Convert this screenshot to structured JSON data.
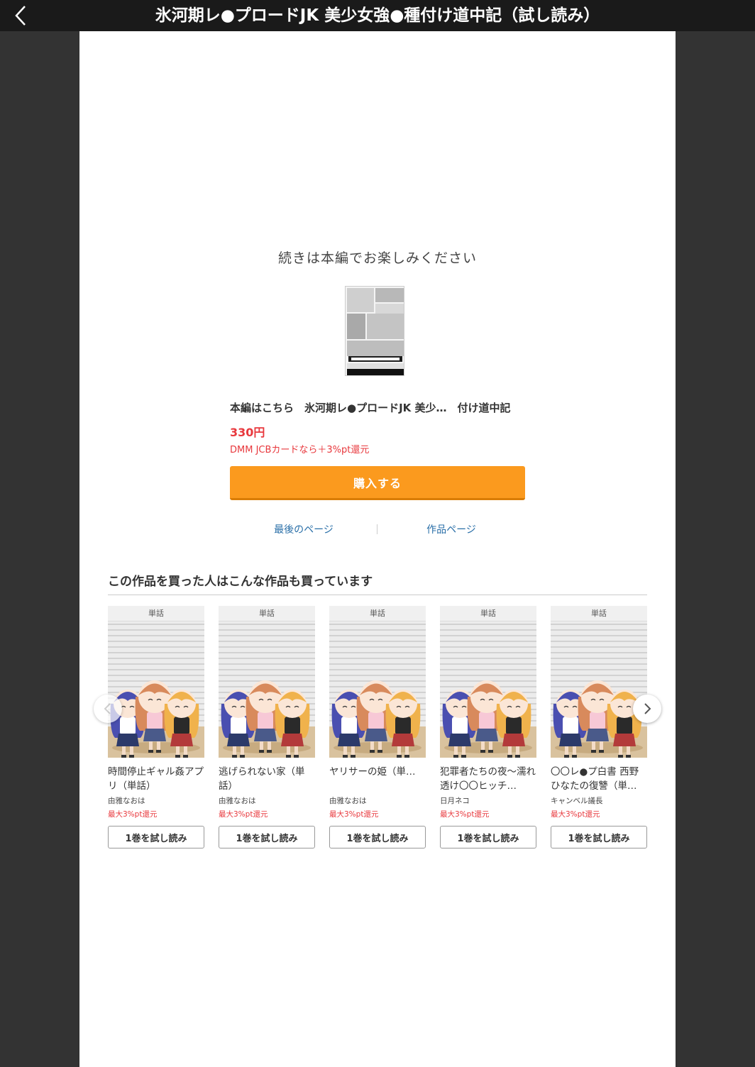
{
  "header": {
    "title": "氷河期レ●プロードJK 美少女強●種付け道中記（試し読み）",
    "back_icon": "chevron-left-icon"
  },
  "end_screen": {
    "message": "続きは本編でお楽しみください",
    "cover_alt": "氷河期レ●プロードJK 美少女強●種付け道中記 cover",
    "buy_title": "本編はこちら　氷河期レ●プロードJK 美少…　付け道中記",
    "price": "330円",
    "point_note": "DMM JCBカードなら＋3%pt還元",
    "buy_button": "購入する",
    "last_page_link": "最後のページ",
    "work_page_link": "作品ページ"
  },
  "recommendations": {
    "heading": "この作品を買った人はこんな作品も買っています",
    "items": [
      {
        "tag": "単話",
        "title": "時間停止ギャル姦アプリ（単話）",
        "author": "由雅なおは",
        "point": "最大3%pt還元",
        "button": "1巻を試し読み"
      },
      {
        "tag": "単話",
        "title": "逃げられない家（単話）",
        "author": "由雅なおは",
        "point": "最大3%pt還元",
        "button": "1巻を試し読み"
      },
      {
        "tag": "単話",
        "title": "ヤリサーの姫（単…",
        "author": "由雅なおは",
        "point": "最大3%pt還元",
        "button": "1巻を試し読み"
      },
      {
        "tag": "単話",
        "title": "犯罪者たちの夜〜濡れ透け〇〇ヒッチ…",
        "author": "日月ネコ",
        "point": "最大3%pt還元",
        "button": "1巻を試し読み"
      },
      {
        "tag": "単話",
        "title": "〇〇レ●プ白書 西野ひなたの復讐（単…",
        "author": "キャンベル議長",
        "point": "最大3%pt還元",
        "button": "1巻を試し読み"
      }
    ],
    "prev_icon": "chevron-left-icon",
    "next_icon": "chevron-right-icon"
  },
  "colors": {
    "accent_orange": "#fb9a1e",
    "price_red": "#e8383d",
    "link_blue": "#2a6fa8",
    "background_dark": "#333333"
  }
}
